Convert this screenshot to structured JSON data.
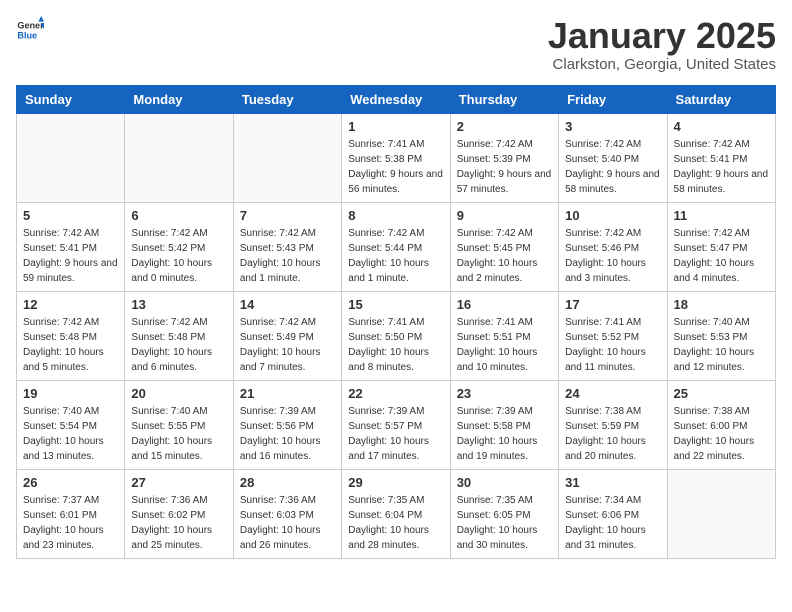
{
  "logo": {
    "general": "General",
    "blue": "Blue"
  },
  "header": {
    "title": "January 2025",
    "subtitle": "Clarkston, Georgia, United States"
  },
  "weekdays": [
    "Sunday",
    "Monday",
    "Tuesday",
    "Wednesday",
    "Thursday",
    "Friday",
    "Saturday"
  ],
  "weeks": [
    [
      {
        "day": "",
        "sunrise": "",
        "sunset": "",
        "daylight": ""
      },
      {
        "day": "",
        "sunrise": "",
        "sunset": "",
        "daylight": ""
      },
      {
        "day": "",
        "sunrise": "",
        "sunset": "",
        "daylight": ""
      },
      {
        "day": "1",
        "sunrise": "7:41 AM",
        "sunset": "5:38 PM",
        "daylight": "9 hours and 56 minutes."
      },
      {
        "day": "2",
        "sunrise": "7:42 AM",
        "sunset": "5:39 PM",
        "daylight": "9 hours and 57 minutes."
      },
      {
        "day": "3",
        "sunrise": "7:42 AM",
        "sunset": "5:40 PM",
        "daylight": "9 hours and 58 minutes."
      },
      {
        "day": "4",
        "sunrise": "7:42 AM",
        "sunset": "5:41 PM",
        "daylight": "9 hours and 58 minutes."
      }
    ],
    [
      {
        "day": "5",
        "sunrise": "7:42 AM",
        "sunset": "5:41 PM",
        "daylight": "9 hours and 59 minutes."
      },
      {
        "day": "6",
        "sunrise": "7:42 AM",
        "sunset": "5:42 PM",
        "daylight": "10 hours and 0 minutes."
      },
      {
        "day": "7",
        "sunrise": "7:42 AM",
        "sunset": "5:43 PM",
        "daylight": "10 hours and 1 minute."
      },
      {
        "day": "8",
        "sunrise": "7:42 AM",
        "sunset": "5:44 PM",
        "daylight": "10 hours and 1 minute."
      },
      {
        "day": "9",
        "sunrise": "7:42 AM",
        "sunset": "5:45 PM",
        "daylight": "10 hours and 2 minutes."
      },
      {
        "day": "10",
        "sunrise": "7:42 AM",
        "sunset": "5:46 PM",
        "daylight": "10 hours and 3 minutes."
      },
      {
        "day": "11",
        "sunrise": "7:42 AM",
        "sunset": "5:47 PM",
        "daylight": "10 hours and 4 minutes."
      }
    ],
    [
      {
        "day": "12",
        "sunrise": "7:42 AM",
        "sunset": "5:48 PM",
        "daylight": "10 hours and 5 minutes."
      },
      {
        "day": "13",
        "sunrise": "7:42 AM",
        "sunset": "5:48 PM",
        "daylight": "10 hours and 6 minutes."
      },
      {
        "day": "14",
        "sunrise": "7:42 AM",
        "sunset": "5:49 PM",
        "daylight": "10 hours and 7 minutes."
      },
      {
        "day": "15",
        "sunrise": "7:41 AM",
        "sunset": "5:50 PM",
        "daylight": "10 hours and 8 minutes."
      },
      {
        "day": "16",
        "sunrise": "7:41 AM",
        "sunset": "5:51 PM",
        "daylight": "10 hours and 10 minutes."
      },
      {
        "day": "17",
        "sunrise": "7:41 AM",
        "sunset": "5:52 PM",
        "daylight": "10 hours and 11 minutes."
      },
      {
        "day": "18",
        "sunrise": "7:40 AM",
        "sunset": "5:53 PM",
        "daylight": "10 hours and 12 minutes."
      }
    ],
    [
      {
        "day": "19",
        "sunrise": "7:40 AM",
        "sunset": "5:54 PM",
        "daylight": "10 hours and 13 minutes."
      },
      {
        "day": "20",
        "sunrise": "7:40 AM",
        "sunset": "5:55 PM",
        "daylight": "10 hours and 15 minutes."
      },
      {
        "day": "21",
        "sunrise": "7:39 AM",
        "sunset": "5:56 PM",
        "daylight": "10 hours and 16 minutes."
      },
      {
        "day": "22",
        "sunrise": "7:39 AM",
        "sunset": "5:57 PM",
        "daylight": "10 hours and 17 minutes."
      },
      {
        "day": "23",
        "sunrise": "7:39 AM",
        "sunset": "5:58 PM",
        "daylight": "10 hours and 19 minutes."
      },
      {
        "day": "24",
        "sunrise": "7:38 AM",
        "sunset": "5:59 PM",
        "daylight": "10 hours and 20 minutes."
      },
      {
        "day": "25",
        "sunrise": "7:38 AM",
        "sunset": "6:00 PM",
        "daylight": "10 hours and 22 minutes."
      }
    ],
    [
      {
        "day": "26",
        "sunrise": "7:37 AM",
        "sunset": "6:01 PM",
        "daylight": "10 hours and 23 minutes."
      },
      {
        "day": "27",
        "sunrise": "7:36 AM",
        "sunset": "6:02 PM",
        "daylight": "10 hours and 25 minutes."
      },
      {
        "day": "28",
        "sunrise": "7:36 AM",
        "sunset": "6:03 PM",
        "daylight": "10 hours and 26 minutes."
      },
      {
        "day": "29",
        "sunrise": "7:35 AM",
        "sunset": "6:04 PM",
        "daylight": "10 hours and 28 minutes."
      },
      {
        "day": "30",
        "sunrise": "7:35 AM",
        "sunset": "6:05 PM",
        "daylight": "10 hours and 30 minutes."
      },
      {
        "day": "31",
        "sunrise": "7:34 AM",
        "sunset": "6:06 PM",
        "daylight": "10 hours and 31 minutes."
      },
      {
        "day": "",
        "sunrise": "",
        "sunset": "",
        "daylight": ""
      }
    ]
  ]
}
